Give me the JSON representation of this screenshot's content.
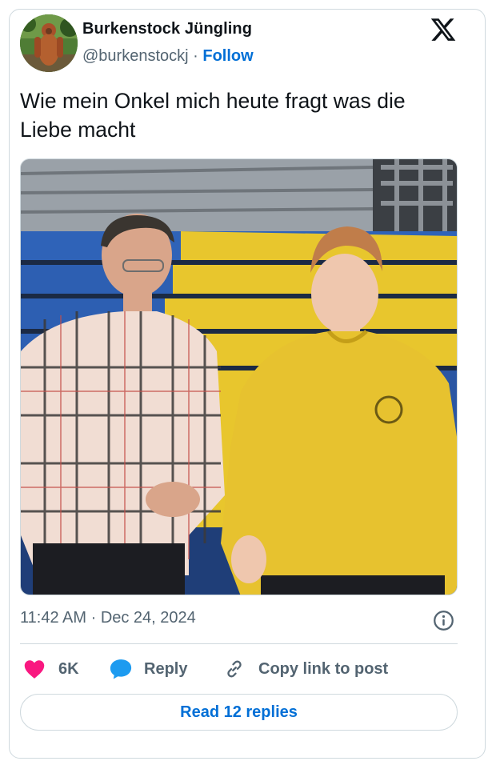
{
  "author": {
    "name": "Burkenstock Jüngling",
    "handle": "@burkenstockj",
    "separator": "·",
    "follow_label": "Follow"
  },
  "tweet": {
    "text_line1": "Wie mein Onkel mich heute fragt was die",
    "text_line2": "Liebe macht",
    "time": "11:42 AM",
    "date": "Dec 24, 2024",
    "meta_separator": " · "
  },
  "actions": {
    "like_count": "6K",
    "reply_label": "Reply",
    "copy_label": "Copy link to post"
  },
  "read_replies_label": "Read 12 replies",
  "icons": [
    "x-logo-icon",
    "info-icon",
    "heart-icon",
    "reply-bubble-icon",
    "link-icon"
  ],
  "colors": {
    "accent": "#006fd6",
    "like": "#f91880",
    "reply": "#1d9bf0",
    "muted": "#536471"
  }
}
